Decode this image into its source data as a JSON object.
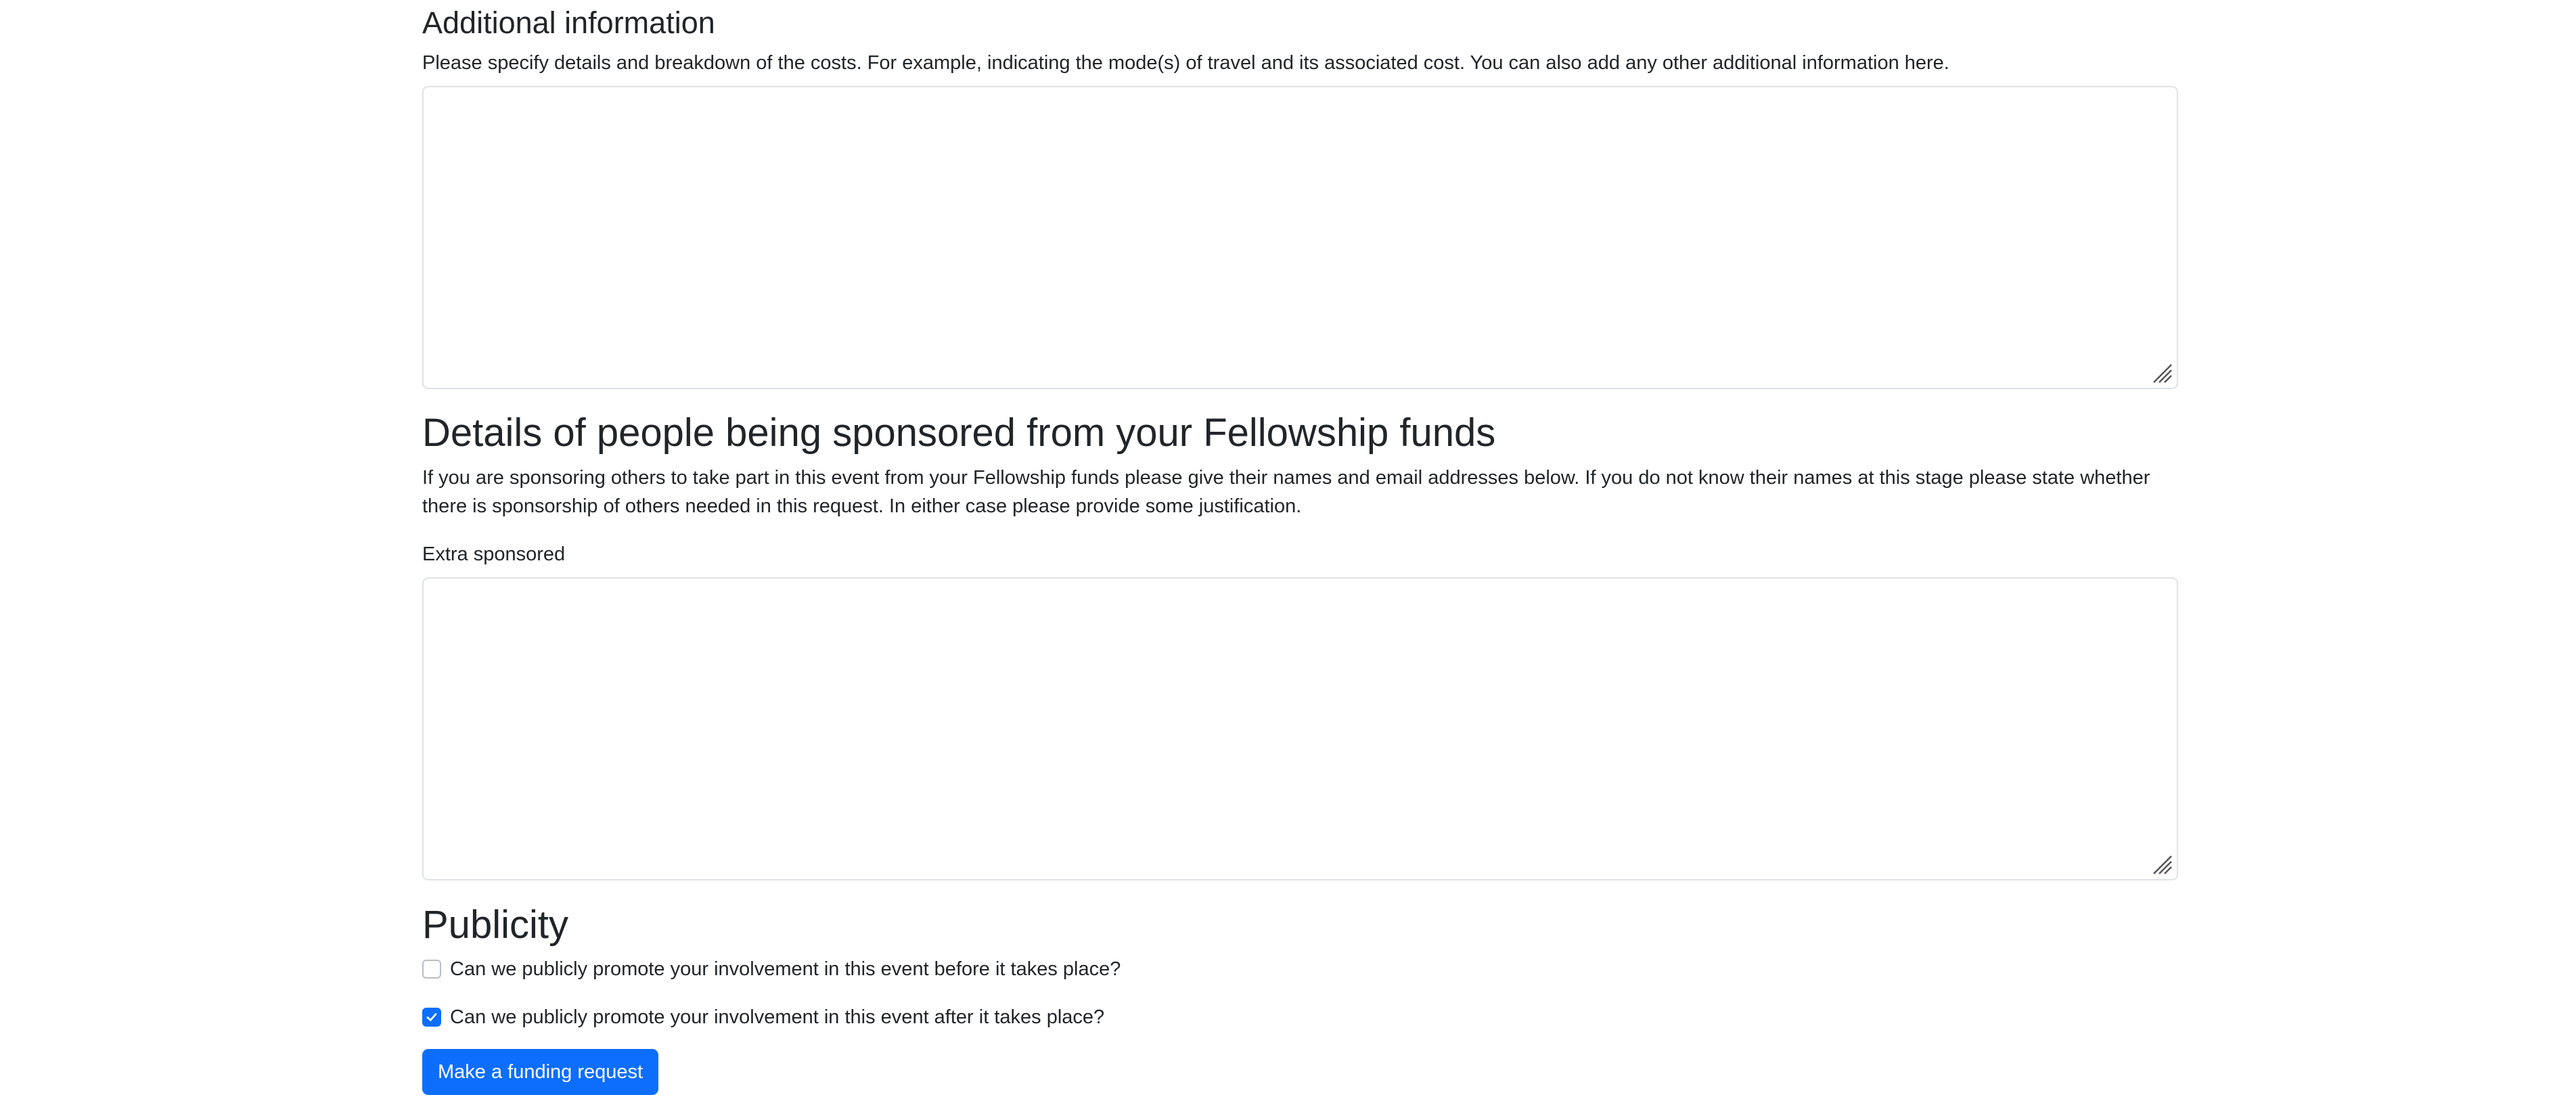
{
  "additional_information": {
    "heading": "Additional information",
    "help_text": "Please specify details and breakdown of the costs. For example, indicating the mode(s) of travel and its associated cost. You can also add any other additional information here.",
    "value": ""
  },
  "sponsored": {
    "heading": "Details of people being sponsored from your Fellowship funds",
    "help_text": "If you are sponsoring others to take part in this event from your Fellowship funds please give their names and email addresses below. If you do not know their names at this stage please state whether there is sponsorship of others needed in this request. In either case please provide some justification.",
    "field_label": "Extra sponsored",
    "value": ""
  },
  "publicity": {
    "heading": "Publicity",
    "options": [
      {
        "label": "Can we publicly promote your involvement in this event before it takes place?",
        "checked": false
      },
      {
        "label": "Can we publicly promote your involvement in this event after it takes place?",
        "checked": true
      }
    ]
  },
  "submit_label": "Make a funding request",
  "colors": {
    "primary": "#0d6efd",
    "text": "#212529",
    "border": "#dee2e6"
  },
  "icons": {
    "resize_grip": "resize-grip-icon",
    "checkmark": "checkmark-icon"
  }
}
